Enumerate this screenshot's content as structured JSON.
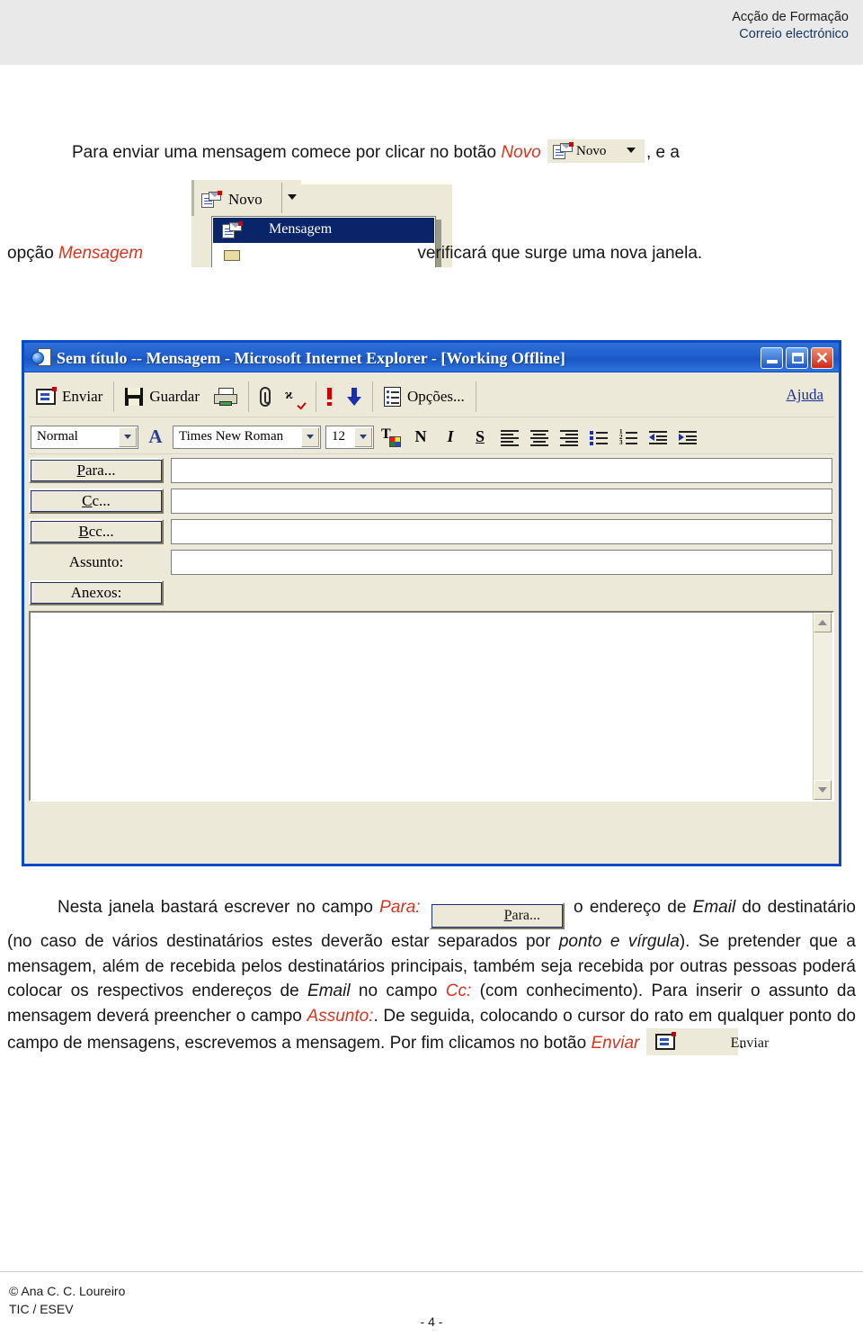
{
  "header": {
    "line1": "Acção de Formação",
    "line2": "Correio electrónico",
    "line2_color": "#17365d"
  },
  "paragraphs": {
    "p1_a": "Para enviar uma mensagem comece por clicar no botão ",
    "p1_em": "Novo",
    "p1_b": ", e a",
    "p2_a": "opção ",
    "p2_em": "Mensagem",
    "p2_b": "verificará que surge uma nova janela.",
    "p3_s1a": "Nesta janela bastará escrever no campo ",
    "p3_s1em": "Para:",
    "p3_s1b": " o endereço de ",
    "p3_s2em": "Email",
    "p3_s2": " do destinatário (no caso de vários destinatários estes deverão estar separados por ",
    "p3_s2it": "ponto e vírgula",
    "p3_s3": "). Se pretender que a mensagem, além de recebida pelos destinatários principais, também seja recebida por outras pessoas poderá colocar os respectivos endereços de ",
    "p3_s3em": "Email",
    "p3_s4": " no campo ",
    "p3_s4em": "Cc:",
    "p3_s5": " (com conhecimento). Para inserir o assunto da mensagem deverá preencher o campo ",
    "p3_s5em": "Assunto:",
    "p3_s6": ". De seguida, colocando o cursor do rato em qualquer ponto do campo de mensagens, escrevemos a mensagem. Por fim clicamos no botão ",
    "p3_s6em": "Enviar",
    "p3_s7": "."
  },
  "novo_button": {
    "label": "Novo",
    "icon": "new-mail-icon",
    "dropdown_icon": "caret-down-icon"
  },
  "novo_menu": {
    "button_label": "Novo",
    "selected_item": "Mensagem",
    "highlight_color": "#0a246a"
  },
  "compose_window": {
    "title": "Sem título -- Mensagem - Microsoft Internet Explorer - [Working Offline]",
    "window_controls": [
      "minimize",
      "maximize",
      "close"
    ],
    "toolbar": [
      {
        "label": "Enviar",
        "icon": "send-mail-icon"
      },
      {
        "label": "Guardar",
        "icon": "save-disk-icon"
      },
      {
        "label": "",
        "icon": "printer-icon"
      },
      {
        "label": "",
        "icon": "paperclip-icon"
      },
      {
        "label": "",
        "icon": "spellcheck-icon"
      },
      {
        "label": "",
        "icon": "high-priority-icon"
      },
      {
        "label": "",
        "icon": "low-priority-icon"
      },
      {
        "label": "Opções...",
        "icon": "options-icon"
      }
    ],
    "help_label": "Ajuda",
    "format_bar": {
      "style": "Normal",
      "font": "Times New Roman",
      "size": "12",
      "font_color_icon": "font-color-icon",
      "paragraph_font_icon": "font-icon",
      "bold": "N",
      "italic": "I",
      "underline": "S",
      "align_left_icon": "align-left-icon",
      "align_center_icon": "align-center-icon",
      "align_right_icon": "align-right-icon",
      "bullet_list_icon": "bulleted-list-icon",
      "numbered_list_icon": "numbered-list-icon",
      "decrease_indent_icon": "decrease-indent-icon",
      "increase_indent_icon": "increase-indent-icon"
    },
    "fields": [
      {
        "label": "Para...",
        "accel": "P",
        "rest": "ara...",
        "type": "button",
        "value": ""
      },
      {
        "label": "Cc...",
        "accel": "C",
        "rest": "c...",
        "type": "button",
        "value": ""
      },
      {
        "label": "Bcc...",
        "accel": "B",
        "rest": "cc...",
        "type": "button",
        "value": ""
      },
      {
        "label": "Assunto:",
        "type": "label",
        "value": ""
      },
      {
        "label": "Anexos:",
        "type": "button",
        "value": ""
      }
    ],
    "body_value": ""
  },
  "inline_para_button": {
    "accel": "P",
    "rest": "ara..."
  },
  "inline_enviar_button": {
    "label": "Enviar"
  },
  "footer": {
    "author": "© Ana C. C. Loureiro",
    "org": "TIC / ESEV",
    "page": "- 4 -"
  }
}
